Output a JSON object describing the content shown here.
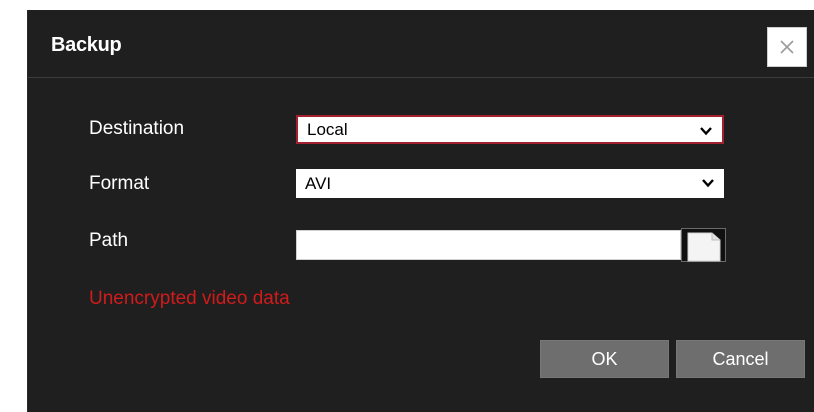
{
  "dialog": {
    "title": "Backup",
    "close_icon": "close-icon"
  },
  "form": {
    "destination": {
      "label": "Destination",
      "value": "Local",
      "icon": "chevron-down-icon"
    },
    "format": {
      "label": "Format",
      "value": "AVI",
      "icon": "chevron-down-icon"
    },
    "path": {
      "label": "Path",
      "value": "",
      "browse_icon": "file-icon"
    },
    "warning": "Unencrypted video data"
  },
  "buttons": {
    "ok_label": "OK",
    "cancel_label": "Cancel"
  },
  "colors": {
    "background": "#1f1f1f",
    "warning": "#d11b1b",
    "focus_border": "#a32030",
    "button": "#6e6e6e"
  }
}
